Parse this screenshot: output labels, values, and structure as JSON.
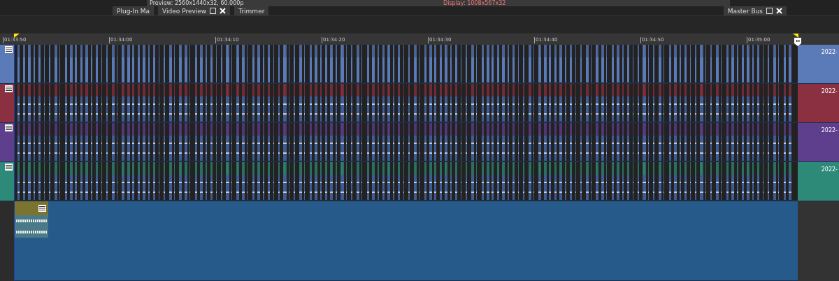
{
  "preview_info": {
    "preview": "Preview: 2560x1440x32, 60.000p",
    "display": "Display: 1008x567x32"
  },
  "dock_tabs": [
    {
      "label": "Plug-In Ma",
      "closable": false
    },
    {
      "label": "Video Preview",
      "closable": true
    },
    {
      "label": "Trimmer",
      "closable": false
    }
  ],
  "master_tab": {
    "label": "Master Bus",
    "closable": true
  },
  "ruler": {
    "labels": [
      "01:33:50",
      "01:34:00",
      "01:34:10",
      "01:34:20",
      "01:34:30",
      "01:34:40",
      "01:34:50",
      "01:35:00"
    ]
  },
  "tracks": [
    {
      "color": "#5a7ab8",
      "kind": "video",
      "clip_label": "2022-"
    },
    {
      "color": "#8a3040",
      "kind": "audio",
      "clip_label": "2022-"
    },
    {
      "color": "#5e3f8e",
      "kind": "audio",
      "clip_label": "2022-"
    },
    {
      "color": "#2e8a78",
      "kind": "audio",
      "clip_label": "2022-"
    }
  ]
}
